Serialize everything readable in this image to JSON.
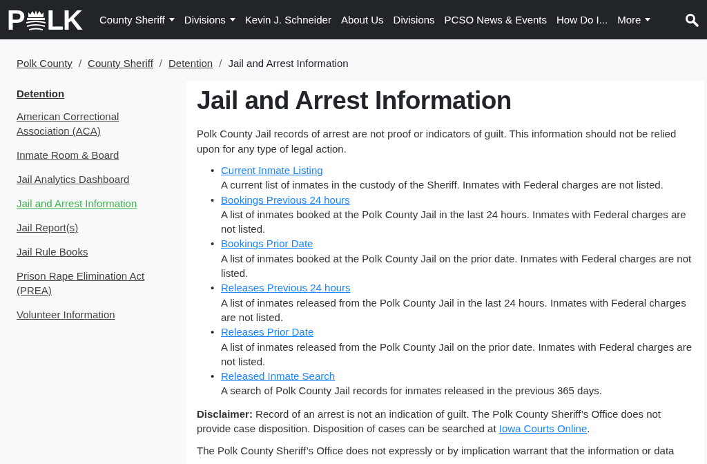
{
  "logo": {
    "left": "P",
    "right": "LK"
  },
  "nav": [
    {
      "label": "County Sheriff",
      "dropdown": true
    },
    {
      "label": "Divisions",
      "dropdown": true
    },
    {
      "label": "Kevin J. Schneider",
      "dropdown": false
    },
    {
      "label": "About Us",
      "dropdown": false
    },
    {
      "label": "Divisions",
      "dropdown": false
    },
    {
      "label": "PCSO News & Events",
      "dropdown": false
    },
    {
      "label": "How Do I...",
      "dropdown": false
    },
    {
      "label": "More",
      "dropdown": true
    }
  ],
  "breadcrumb": {
    "separators": [
      "/",
      "/",
      "/"
    ],
    "links": [
      "Polk County",
      "County Sheriff",
      "Detention"
    ],
    "current": "Jail and Arrest Information"
  },
  "sidebar": {
    "heading": "Detention",
    "items": [
      {
        "label": "American Correctional Association (ACA)",
        "selected": false
      },
      {
        "label": "Inmate Room & Board",
        "selected": false
      },
      {
        "label": "Jail Analytics Dashboard",
        "selected": false
      },
      {
        "label": "Jail and Arrest Information",
        "selected": true
      },
      {
        "label": "Jail Report(s)",
        "selected": false
      },
      {
        "label": "Jail Rule Books",
        "selected": false
      },
      {
        "label": "Prison Rape Elimination Act (PREA)",
        "selected": false
      },
      {
        "label": "Volunteer Information",
        "selected": false
      }
    ]
  },
  "main": {
    "title": "Jail and Arrest Information",
    "intro": "Polk County Jail records of arrest are not proof or indicators of guilt. This information should not be relied upon for any type of legal action.",
    "links": [
      {
        "bullet": "•",
        "label": "Current Inmate Listing",
        "description": "A current list of inmates in the custody of the Sheriff. Inmates with Federal charges are not listed."
      },
      {
        "bullet": "•",
        "label": "Bookings Previous 24 hours",
        "description": "A list of inmates booked at the Polk County Jail in the last 24 hours. Inmates with Federal charges are not listed."
      },
      {
        "bullet": "•",
        "label": "Bookings Prior Date",
        "description": "A list of inmates booked at the Polk County Jail on the prior date. Inmates with Federal charges are not listed."
      },
      {
        "bullet": "•",
        "label": "Releases Previous 24 hours",
        "description": "A list of inmates released from the Polk County Jail in the last 24 hours. Inmates with Federal charges are not listed."
      },
      {
        "bullet": "•",
        "label": "Releases Prior Date",
        "description": "A list of inmates released from the Polk County Jail on the prior date. Inmates with Federal charges are not listed."
      },
      {
        "bullet": "•",
        "label": "Released Inmate Search",
        "description": "A search of Polk County Jail records for inmates released in the previous 365 days."
      }
    ],
    "disclaimer": {
      "label": "Disclaimer:",
      "text": " Record of an arrest is not an indication of guilt. The Polk County Sheriff’s Office does not provide case disposition. Disposition of cases can be searched at ",
      "link": "Iowa Courts Online",
      "end": "."
    },
    "closing": "The Polk County Sheriff’s Office does not expressly or by implication warrant that the information or data"
  }
}
